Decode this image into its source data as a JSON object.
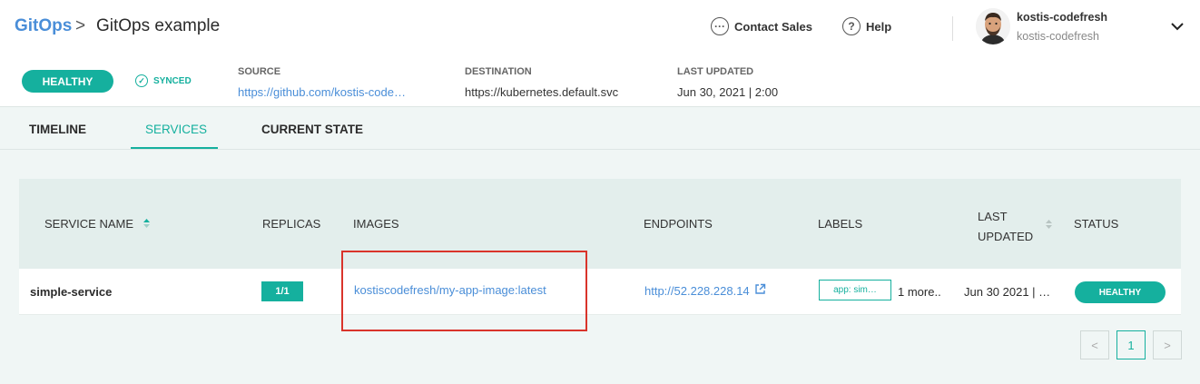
{
  "breadcrumb": {
    "root": "GitOps",
    "separator": ">",
    "current": "GitOps example"
  },
  "header": {
    "contact_label": "Contact Sales",
    "help_label": "Help",
    "user": {
      "name": "kostis-codefresh",
      "account": "kostis-codefresh"
    }
  },
  "app_status": {
    "health": "HEALTHY",
    "sync": "SYNCED",
    "source": {
      "label": "SOURCE",
      "value": "https://github.com/kostis-code…"
    },
    "destination": {
      "label": "DESTINATION",
      "value": "https://kubernetes.default.svc"
    },
    "last_updated": {
      "label": "LAST UPDATED",
      "value": "Jun 30, 2021 | 2:00"
    }
  },
  "tabs": [
    {
      "label": "TIMELINE"
    },
    {
      "label": "SERVICES",
      "active": true
    },
    {
      "label": "CURRENT STATE"
    }
  ],
  "table": {
    "columns": {
      "service_name": "SERVICE NAME",
      "replicas": "REPLICAS",
      "images": "IMAGES",
      "endpoints": "ENDPOINTS",
      "labels": "LABELS",
      "last_updated_1": "LAST",
      "last_updated_2": "UPDATED",
      "status": "STATUS"
    },
    "rows": [
      {
        "service_name": "simple-service",
        "replicas": "1/1",
        "image": "kostiscodefresh/my-app-image:latest",
        "endpoint": "http://52.228.228.14",
        "label_chip": "app: sim…",
        "labels_more": "1 more..",
        "last_updated": "Jun 30 2021 | …",
        "status": "HEALTHY"
      }
    ]
  },
  "pagination": {
    "prev": "<",
    "page": "1",
    "next": ">"
  },
  "colors": {
    "accent": "#15b09e",
    "link": "#4a8ed8",
    "highlight": "#d9342b"
  }
}
